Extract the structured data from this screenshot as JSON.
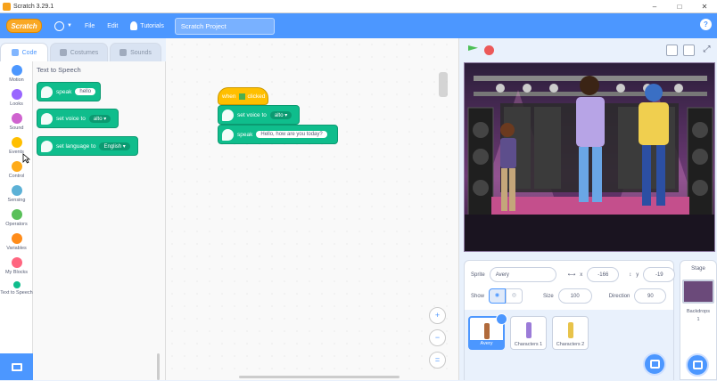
{
  "window": {
    "title": "Scratch 3.29.1"
  },
  "menu": {
    "logo": "Scratch",
    "file": "File",
    "edit": "Edit",
    "tutorials": "Tutorials",
    "project_title": "Scratch Project"
  },
  "tabs": {
    "code": "Code",
    "costumes": "Costumes",
    "sounds": "Sounds"
  },
  "categories": [
    {
      "label": "Motion",
      "color": "#4c97ff"
    },
    {
      "label": "Looks",
      "color": "#9966ff"
    },
    {
      "label": "Sound",
      "color": "#cf63cf"
    },
    {
      "label": "Events",
      "color": "#ffbf00"
    },
    {
      "label": "Control",
      "color": "#ffab19"
    },
    {
      "label": "Sensing",
      "color": "#5cb1d6"
    },
    {
      "label": "Operators",
      "color": "#59c059"
    },
    {
      "label": "Variables",
      "color": "#ff8c1a"
    },
    {
      "label": "My Blocks",
      "color": "#ff6680"
    },
    {
      "label": "Text to Speech",
      "color": "#0fbd8c"
    }
  ],
  "palette": {
    "title": "Text to Speech",
    "speak_label": "speak",
    "speak_value": "hello",
    "voice_label": "set voice to",
    "voice_value": "alto",
    "language_label": "set language to",
    "language_value": "English"
  },
  "script": {
    "hat_label": "when",
    "hat_suffix": "clicked",
    "voice_label": "set voice to",
    "voice_value": "alto",
    "speak_label": "speak",
    "speak_value": "Hello, how are you today?"
  },
  "sprite_info": {
    "sprite_label": "Sprite",
    "sprite_name": "Avery",
    "x_label": "x",
    "x_value": "-166",
    "y_label": "y",
    "y_value": "-19",
    "show_label": "Show",
    "size_label": "Size",
    "size_value": "100",
    "direction_label": "Direction",
    "direction_value": "90"
  },
  "sprites": [
    {
      "name": "Avery",
      "selected": true,
      "color": "#b06a3b"
    },
    {
      "name": "Characters 1",
      "selected": false,
      "color": "#9b7bd8"
    },
    {
      "name": "Characters 2",
      "selected": false,
      "color": "#e8c34a"
    }
  ],
  "stage_pane": {
    "title": "Stage",
    "backdrops_label": "Backdrops",
    "backdrops_count": "1"
  },
  "colors": {
    "accent": "#4c97ff",
    "tts_green": "#0fbd8c",
    "events_yellow": "#ffbf00"
  }
}
